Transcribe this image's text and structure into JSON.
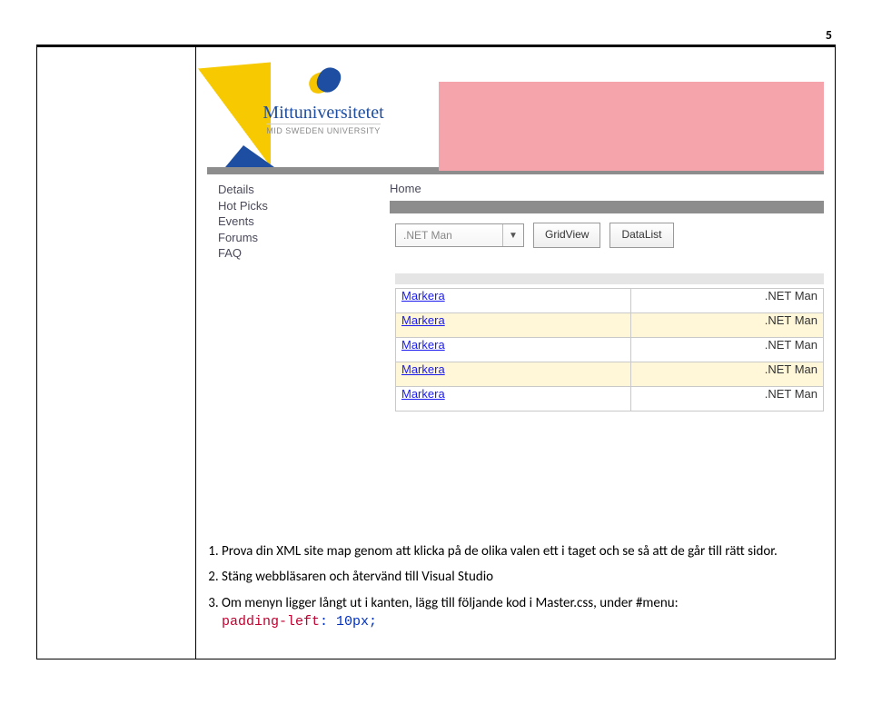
{
  "page_number": "5",
  "logo": {
    "word": "Mittuniversitetet",
    "sub": "MID SWEDEN UNIVERSITY"
  },
  "sidebar": {
    "items": [
      "Details",
      "Hot Picks",
      "Events",
      "Forums",
      "FAQ"
    ]
  },
  "breadcrumb": "Home",
  "controls": {
    "dropdown_value": ".NET Man",
    "button_gridview": "GridView",
    "button_datalist": "DataList"
  },
  "table": {
    "rows": [
      {
        "mark": "Markera",
        "dot": ".NET Man",
        "alt": false
      },
      {
        "mark": "Markera",
        "dot": ".NET Man",
        "alt": true
      },
      {
        "mark": "Markera",
        "dot": ".NET Man",
        "alt": false
      },
      {
        "mark": "Markera",
        "dot": ".NET Man",
        "alt": true
      },
      {
        "mark": "Markera",
        "dot": ".NET Man",
        "alt": false
      }
    ]
  },
  "doc": {
    "items": [
      "Prova din XML site map genom att klicka på de olika valen ett i taget och se så att de går till rätt sidor.",
      "Stäng webbläsaren och återvänd till Visual Studio",
      "Om menyn ligger långt ut i kanten, lägg till följande kod i Master.css, under #menu:"
    ],
    "code_red": "padding-left",
    "code_blue": ": 10px;"
  }
}
